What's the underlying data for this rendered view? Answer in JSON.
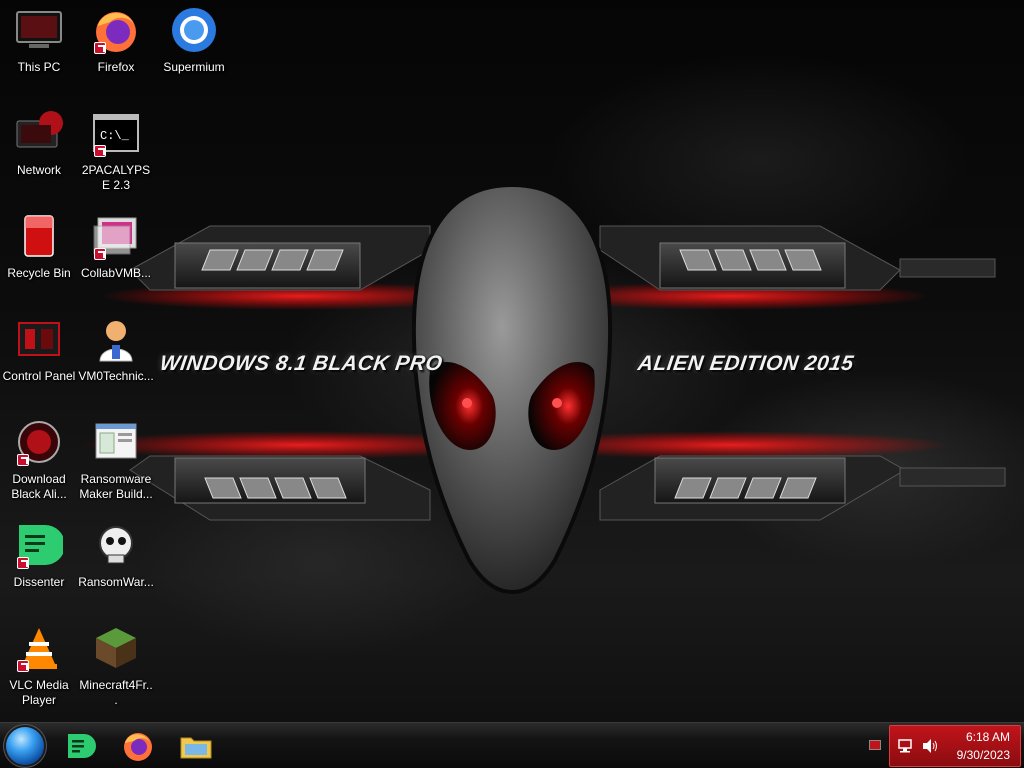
{
  "desktop": {
    "wallpaper": {
      "left_text": "WINDOWS 8.1 BLACK PRO",
      "right_text": "ALIEN EDITION 2015"
    },
    "icons": [
      {
        "label": "This PC",
        "icon": "computer-icon"
      },
      {
        "label": "Firefox",
        "icon": "firefox-icon"
      },
      {
        "label": "Supermium",
        "icon": "supermium-icon"
      },
      {
        "label": "Network",
        "icon": "network-icon"
      },
      {
        "label": "2PACALYPSE 2.3",
        "icon": "terminal-icon"
      },
      {
        "label": "Recycle Bin",
        "icon": "recycle-bin-icon"
      },
      {
        "label": "CollabVMB...",
        "icon": "collabvm-icon"
      },
      {
        "label": "Control Panel",
        "icon": "control-panel-icon"
      },
      {
        "label": "VM0Technic...",
        "icon": "technician-icon"
      },
      {
        "label": "Download Black Ali...",
        "icon": "alien-download-icon"
      },
      {
        "label": "Ransomware Maker Build...",
        "icon": "builder-window-icon"
      },
      {
        "label": "Dissenter",
        "icon": "dissenter-icon"
      },
      {
        "label": "RansomWar...",
        "icon": "skull-icon"
      },
      {
        "label": "VLC Media Player",
        "icon": "vlc-icon"
      },
      {
        "label": "Minecraft4Fr...",
        "icon": "minecraft-icon"
      }
    ]
  },
  "taskbar": {
    "pinned": [
      {
        "name": "Dissenter",
        "icon": "dissenter-icon"
      },
      {
        "name": "Firefox",
        "icon": "firefox-icon"
      },
      {
        "name": "File Explorer",
        "icon": "folder-icon"
      }
    ],
    "clock": {
      "time": "6:18 AM",
      "date": "9/30/2023"
    }
  },
  "colors": {
    "accent_red": "#c0141a",
    "start_blue": "#3aa0f0",
    "dissenter_green": "#2ecc71"
  }
}
